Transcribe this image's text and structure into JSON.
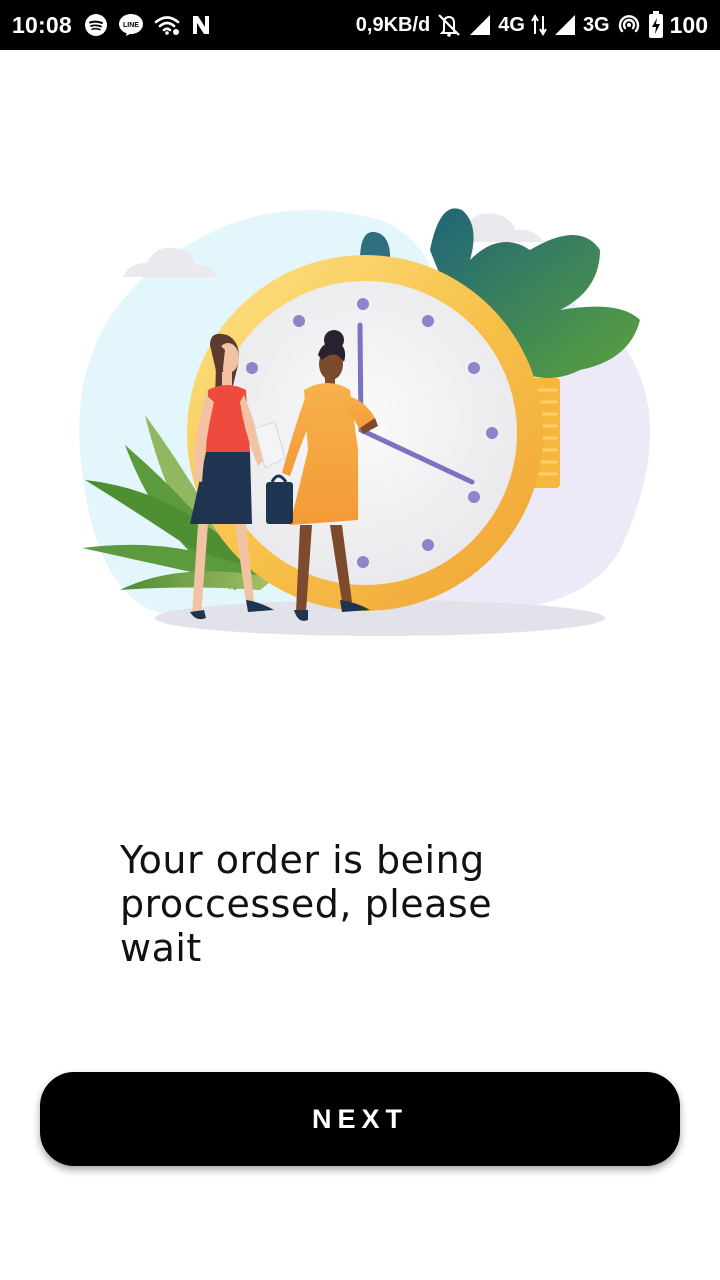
{
  "status_bar": {
    "time": "10:08",
    "network_speed": "0,9KB/d",
    "network_4g": "4G",
    "network_3g": "3G",
    "battery": "100",
    "left_icons": [
      "spotify-icon",
      "line-icon",
      "wifi-icon",
      "n-app-icon"
    ],
    "right_icons": [
      "bell-off-icon",
      "signal-icon",
      "data-arrows-icon",
      "signal-icon",
      "hotspot-icon",
      "battery-charging-icon"
    ]
  },
  "illustration": {
    "name": "clock-with-two-women-illustration",
    "colors": {
      "blob_blue": "#e3f6fb",
      "blob_lavender": "#eceaf9",
      "clock_rim": "#f5b83d",
      "clock_face": "#f4f4f6",
      "clock_hands": "#7b73c2",
      "leaf_green": "#5c9a3e",
      "leaf_teal": "#2f6f80",
      "cloud": "#e9e9ee"
    }
  },
  "message": {
    "text": "Your order is being proccessed, please wait"
  },
  "next_button": {
    "label": "NEXT",
    "background": "#000000",
    "text_color": "#ffffff"
  }
}
